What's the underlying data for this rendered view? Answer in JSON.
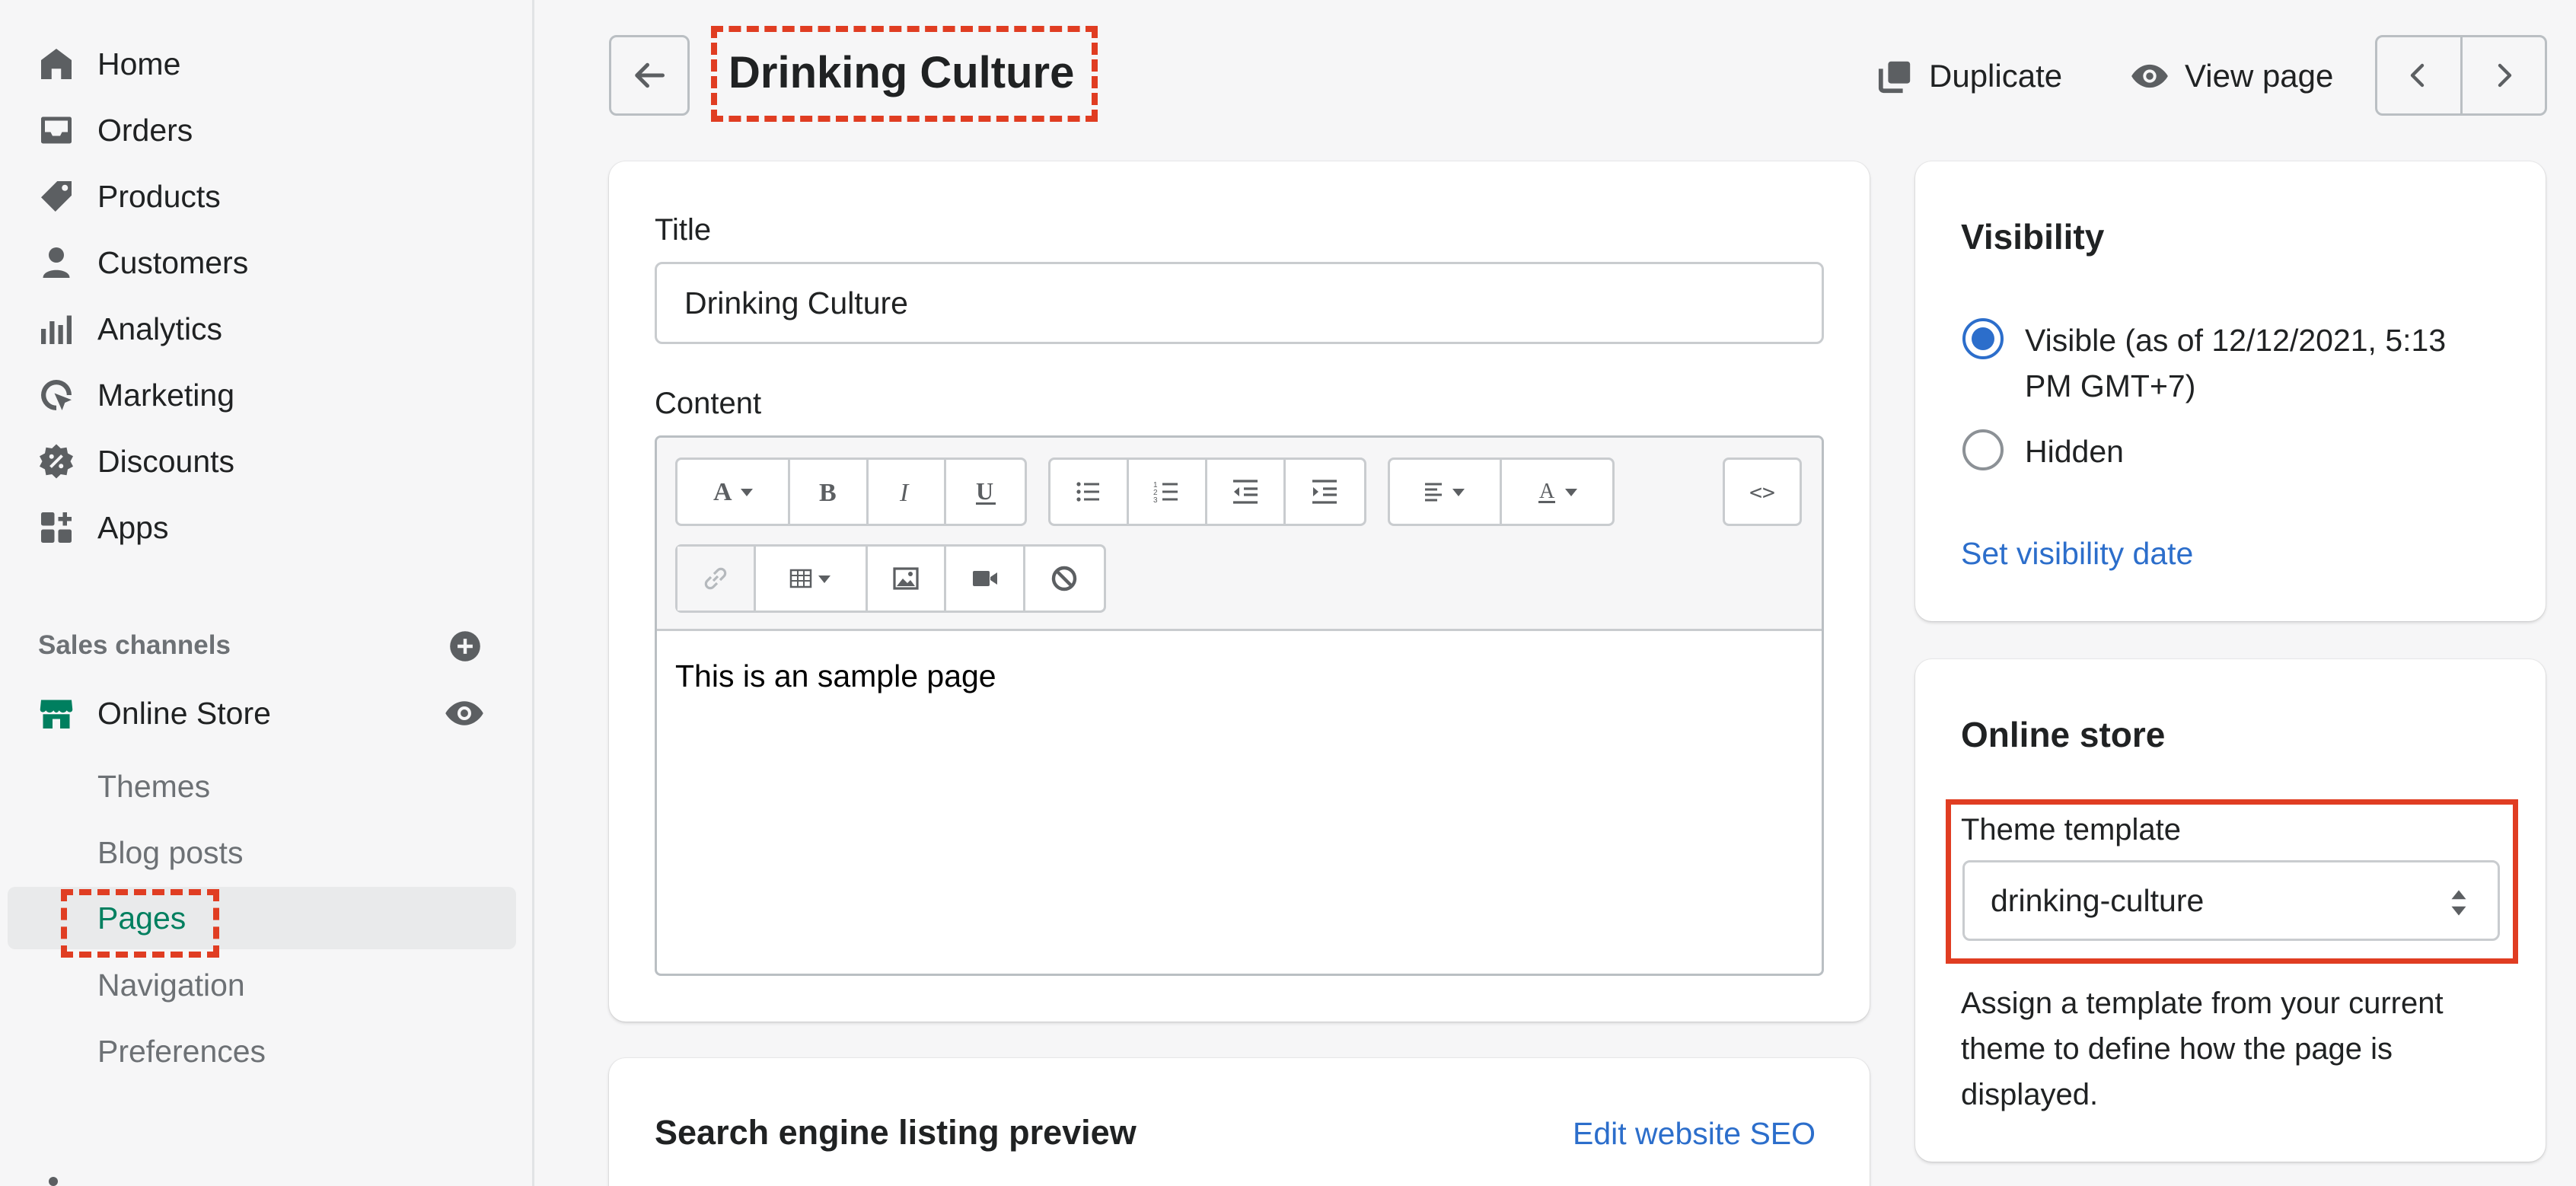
{
  "sidebar": {
    "items": [
      {
        "label": "Home",
        "icon": "home-icon"
      },
      {
        "label": "Orders",
        "icon": "orders-icon"
      },
      {
        "label": "Products",
        "icon": "tag-icon"
      },
      {
        "label": "Customers",
        "icon": "person-icon"
      },
      {
        "label": "Analytics",
        "icon": "bar-chart-icon"
      },
      {
        "label": "Marketing",
        "icon": "marketing-icon"
      },
      {
        "label": "Discounts",
        "icon": "discount-icon"
      },
      {
        "label": "Apps",
        "icon": "apps-icon"
      }
    ],
    "sales_channels_label": "Sales channels",
    "online_store": {
      "label": "Online Store",
      "subitems": [
        "Themes",
        "Blog posts",
        "Pages",
        "Navigation",
        "Preferences"
      ],
      "active": "Pages"
    }
  },
  "header": {
    "title": "Drinking Culture",
    "duplicate_label": "Duplicate",
    "view_page_label": "View page"
  },
  "page_form": {
    "title_label": "Title",
    "title_value": "Drinking Culture",
    "content_label": "Content",
    "content_text": "This is an sample page",
    "html_button_label": "<>"
  },
  "seo": {
    "heading": "Search engine listing preview",
    "edit_link": "Edit website SEO"
  },
  "visibility": {
    "heading": "Visibility",
    "visible_label_line1": "Visible (as of 12/12/2021, 5:13",
    "visible_label_line2": "PM GMT+7)",
    "hidden_label": "Hidden",
    "selected": "visible",
    "set_date_link": "Set visibility date"
  },
  "online_store_card": {
    "heading": "Online store",
    "template_label": "Theme template",
    "template_value": "drinking-culture",
    "help_line1": "Assign a template from your current",
    "help_line2": "theme to define how the page is",
    "help_line3": "displayed."
  },
  "colors": {
    "accent_green": "#007f5f",
    "link_blue": "#2c6ecb",
    "annotation_red": "#e03d22"
  }
}
